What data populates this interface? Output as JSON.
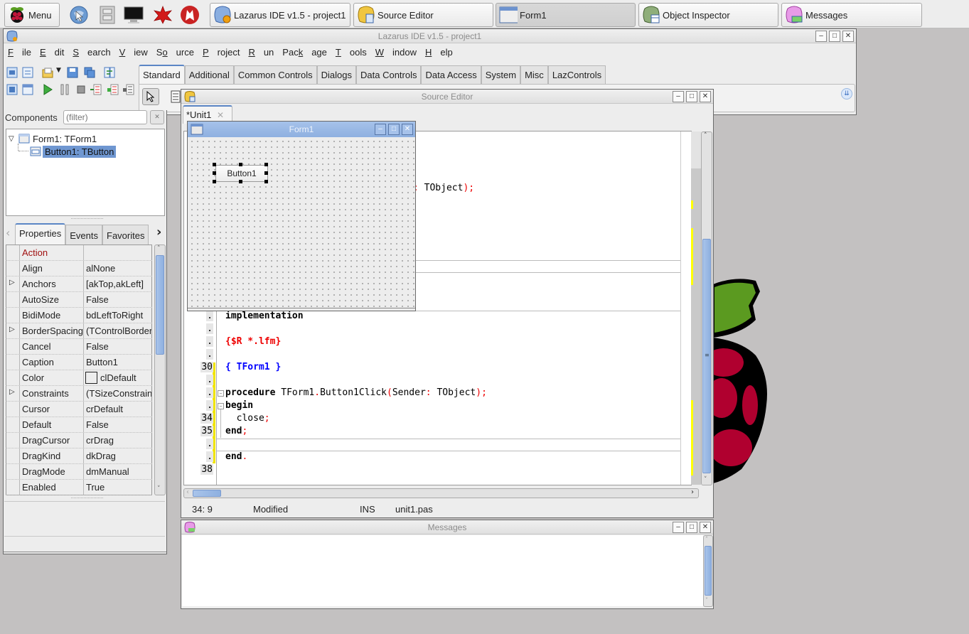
{
  "taskbar": {
    "menu_label": "Menu",
    "launchers": [
      "web-browser",
      "file-manager",
      "terminal",
      "mathematica",
      "wolfram"
    ],
    "tasks": [
      {
        "label": "Lazarus IDE v1.5 - project1",
        "icon": "lazarus-ide-icon",
        "active": false
      },
      {
        "label": "Source Editor",
        "icon": "source-editor-icon",
        "active": false
      },
      {
        "label": "Form1",
        "icon": "form-window-icon",
        "active": true
      },
      {
        "label": "Object Inspector",
        "icon": "object-inspector-icon",
        "active": false
      },
      {
        "label": "Messages",
        "icon": "messages-icon",
        "active": false
      }
    ]
  },
  "ide": {
    "title": "Lazarus IDE v1.5 - project1",
    "menu": [
      {
        "label": "File",
        "mnemonic": "F"
      },
      {
        "label": "Edit",
        "mnemonic": "E"
      },
      {
        "label": "Search",
        "mnemonic": "S"
      },
      {
        "label": "View",
        "mnemonic": "V"
      },
      {
        "label": "Source",
        "mnemonic": "o"
      },
      {
        "label": "Project",
        "mnemonic": "P"
      },
      {
        "label": "Run",
        "mnemonic": "R"
      },
      {
        "label": "Package",
        "mnemonic": "k"
      },
      {
        "label": "Tools",
        "mnemonic": "T"
      },
      {
        "label": "Window",
        "mnemonic": "W"
      },
      {
        "label": "Help",
        "mnemonic": "H"
      }
    ],
    "palette_tabs": [
      "Standard",
      "Additional",
      "Common Controls",
      "Dialogs",
      "Data Controls",
      "Data Access",
      "System",
      "Misc",
      "LazControls"
    ],
    "active_palette_tab": "Standard"
  },
  "object_inspector": {
    "components_label": "Components",
    "filter_placeholder": "(filter)",
    "tree": [
      {
        "label": "Form1: TForm1",
        "level": 0,
        "expanded": true,
        "selected": false
      },
      {
        "label": "Button1: TButton",
        "level": 1,
        "selected": true
      }
    ],
    "tabs": [
      "Properties",
      "Events",
      "Favorites"
    ],
    "active_tab": "Properties",
    "properties": [
      {
        "name": "Action",
        "value": "",
        "expandable": false,
        "highlight": true
      },
      {
        "name": "Align",
        "value": "alNone",
        "expandable": false
      },
      {
        "name": "Anchors",
        "value": "[akTop,akLeft]",
        "expandable": true
      },
      {
        "name": "AutoSize",
        "value": "False",
        "expandable": false
      },
      {
        "name": "BidiMode",
        "value": "bdLeftToRight",
        "expandable": false
      },
      {
        "name": "BorderSpacing",
        "value": "(TControlBorderSpacing)",
        "expandable": true
      },
      {
        "name": "Cancel",
        "value": "False",
        "expandable": false
      },
      {
        "name": "Caption",
        "value": "Button1",
        "expandable": false
      },
      {
        "name": "Color",
        "value": "clDefault",
        "expandable": false,
        "swatch": true
      },
      {
        "name": "Constraints",
        "value": "(TSizeConstraints)",
        "expandable": true
      },
      {
        "name": "Cursor",
        "value": "crDefault",
        "expandable": false
      },
      {
        "name": "Default",
        "value": "False",
        "expandable": false
      },
      {
        "name": "DragCursor",
        "value": "crDrag",
        "expandable": false
      },
      {
        "name": "DragKind",
        "value": "dkDrag",
        "expandable": false
      },
      {
        "name": "DragMode",
        "value": "dmManual",
        "expandable": false
      },
      {
        "name": "Enabled",
        "value": "True",
        "expandable": false
      }
    ]
  },
  "source_editor": {
    "title": "Source Editor",
    "tab_label": "*Unit1",
    "visible_fragment": ": TObject);",
    "gutter": [
      ".",
      ".",
      ".",
      ".",
      "30",
      ".",
      ".",
      ".",
      "34",
      "35",
      ".",
      ".",
      "38"
    ],
    "lines": [
      {
        "text": "implementation"
      },
      {
        "text": ""
      },
      {
        "text": "{$R *.lfm}"
      },
      {
        "text": ""
      },
      {
        "text": "{ TForm1 }"
      },
      {
        "text": ""
      },
      {
        "text": "procedure TForm1.Button1Click(Sender: TObject);"
      },
      {
        "text": "begin"
      },
      {
        "text": "  close;"
      },
      {
        "text": "end;"
      },
      {
        "text": ""
      },
      {
        "text": "end."
      },
      {
        "text": ""
      }
    ],
    "status": {
      "position": "34:  9",
      "modified": "Modified",
      "mode": "INS",
      "file": "unit1.pas"
    }
  },
  "form_designer": {
    "title": "Form1",
    "button_caption": "Button1"
  },
  "messages": {
    "title": "Messages"
  },
  "colors": {
    "accent": "#5b86c5",
    "selection": "#6f97d1",
    "keyword_red": "#e00000",
    "comment_blue": "#0000ff",
    "modified_line": "#f0e400",
    "property_highlight": "#a01010",
    "desktop": "#c3c1c1"
  }
}
